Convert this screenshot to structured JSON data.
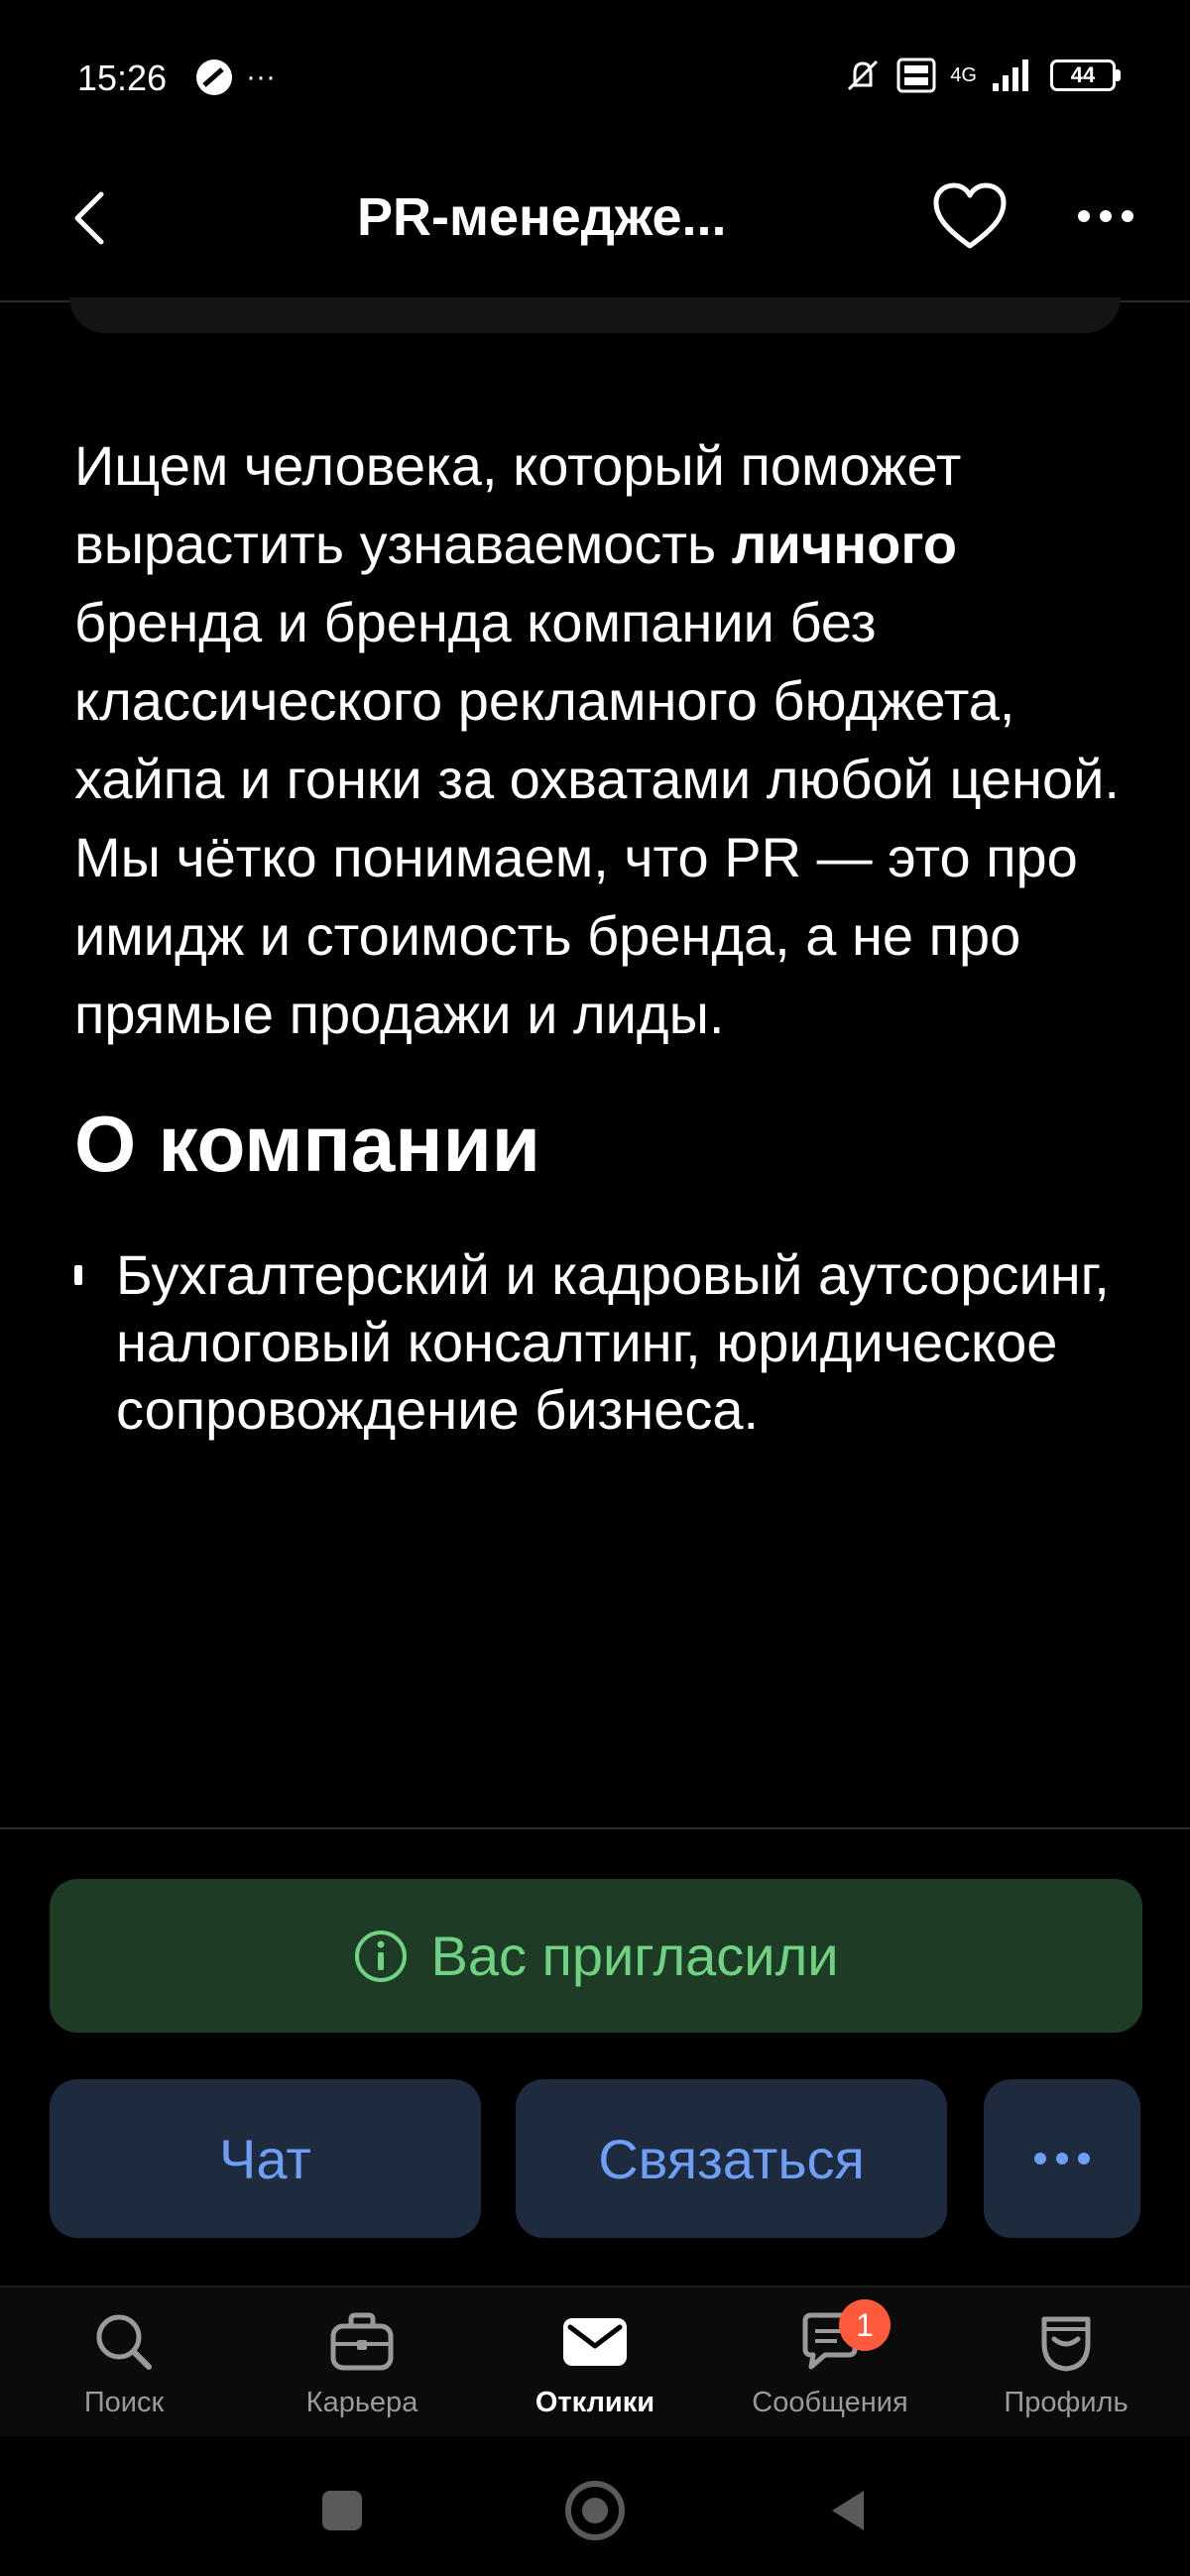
{
  "status_bar": {
    "time": "15:26",
    "extra": "···",
    "network": "4G",
    "battery": "44"
  },
  "app_bar": {
    "title": "PR-менедже..."
  },
  "content": {
    "description_before": "Ищем человека, который поможет вырастить узнаваемость ",
    "description_bold": "личного",
    "description_after": " бренда и бренда компании без классического рекламного бюджета, хайпа и гонки за охватами любой ценой. Мы чётко понимаем, что PR — это про имидж и стоимость бренда, а не про прямые продажи и лиды.",
    "section_title": "О компании",
    "bullets": [
      "Бухгалтерский и кадровый аутсорсинг, налоговый консалтинг, юридическое сопровождение бизнеса."
    ]
  },
  "invited_banner": {
    "label": "Вас пригласили"
  },
  "actions": {
    "chat": "Чат",
    "contact": "Связаться"
  },
  "bottom_nav": {
    "items": [
      {
        "label": "Поиск",
        "icon": "search-icon"
      },
      {
        "label": "Карьера",
        "icon": "briefcase-icon"
      },
      {
        "label": "Отклики",
        "icon": "envelope-icon",
        "active": true
      },
      {
        "label": "Сообщения",
        "icon": "chat-bubble-icon",
        "badge": "1"
      },
      {
        "label": "Профиль",
        "icon": "profile-icon"
      }
    ]
  },
  "colors": {
    "background": "#000000",
    "invited_bg": "#1e3b26",
    "invited_text": "#6fd283",
    "button_bg": "#1e2a3e",
    "button_text": "#6f9ef5",
    "badge": "#ff5a3c"
  }
}
